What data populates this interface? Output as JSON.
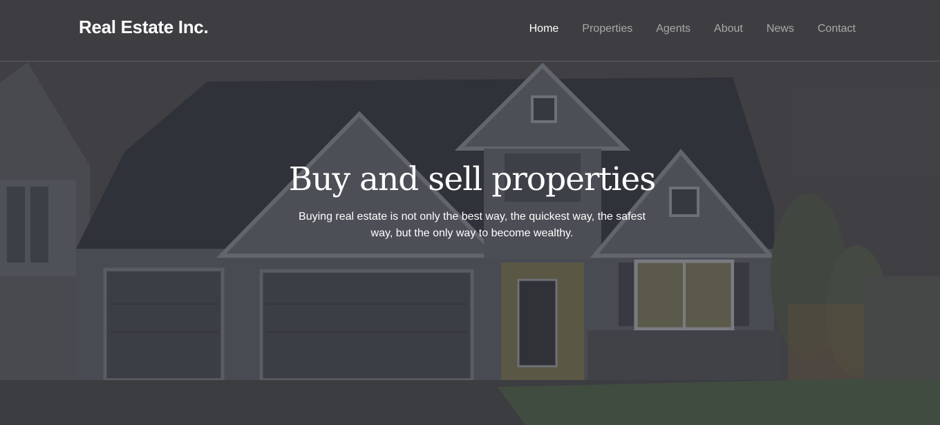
{
  "brand": {
    "name": "Real Estate Inc."
  },
  "nav": {
    "items": [
      {
        "label": "Home",
        "active": true
      },
      {
        "label": "Properties",
        "active": false
      },
      {
        "label": "Agents",
        "active": false
      },
      {
        "label": "About",
        "active": false
      },
      {
        "label": "News",
        "active": false
      },
      {
        "label": "Contact",
        "active": false
      }
    ]
  },
  "hero": {
    "title": "Buy and sell properties",
    "subtitle": "Buying real estate is not only the best way, the quickest way, the safest way, but the only way to become wealthy."
  }
}
